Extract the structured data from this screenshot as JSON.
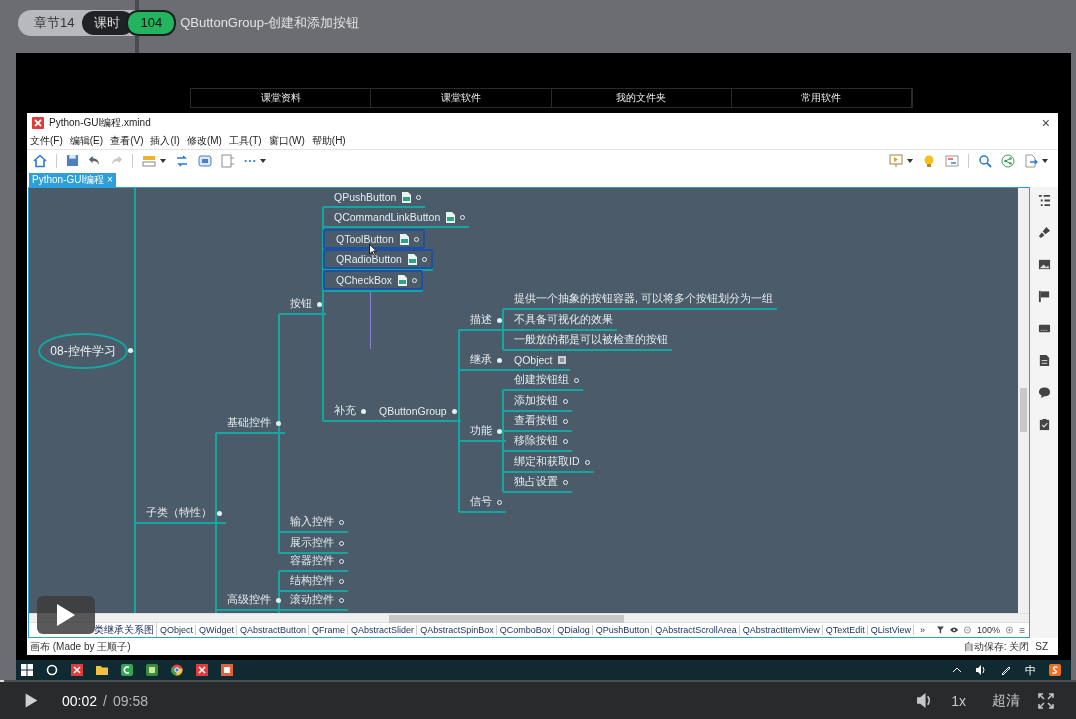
{
  "lesson": {
    "chapter": "章节14",
    "label": "课时",
    "number": "104",
    "title": "QButtonGroup-创建和添加按钮"
  },
  "remote_tabs": [
    "课堂资料",
    "课堂软件",
    "我的文件夹",
    "常用软件"
  ],
  "xmind": {
    "title": "Python-GUI编程.xmind",
    "close": "×",
    "menu": [
      "文件(F)",
      "编辑(E)",
      "查看(V)",
      "插入(I)",
      "修改(M)",
      "工具(T)",
      "窗口(W)",
      "帮助(H)"
    ],
    "doc_tab": {
      "label": "Python-GUI编程",
      "close": "×"
    },
    "mindmap": {
      "label": "08-控件学习",
      "kind": "central",
      "selected": false,
      "children": [
        {
          "label": "子类（特性）",
          "kind": "topic",
          "selected": false,
          "children": [
            {
              "label": "基础控件",
              "kind": "topic",
              "selected": false,
              "children": [
                {
                  "label": "按钮",
                  "kind": "topic",
                  "selected": false,
                  "children": [
                    {
                      "label": "QPushButton",
                      "kind": "note",
                      "selected": false,
                      "collapsed": true
                    },
                    {
                      "label": "QCommandLinkButton",
                      "kind": "note",
                      "selected": false,
                      "collapsed": true
                    },
                    {
                      "label": "QToolButton",
                      "kind": "note",
                      "selected": true,
                      "collapsed": true
                    },
                    {
                      "label": "QRadioButton",
                      "kind": "note",
                      "selected": true,
                      "collapsed": true
                    },
                    {
                      "label": "QCheckBox",
                      "kind": "note",
                      "selected": true,
                      "collapsed": true
                    },
                    {
                      "label": "补充",
                      "kind": "topic",
                      "selected": false,
                      "children": [
                        {
                          "label": "QButtonGroup",
                          "kind": "topic",
                          "selected": false,
                          "children": [
                            {
                              "label": "描述",
                              "kind": "topic",
                              "selected": false,
                              "children": [
                                {
                                  "label": "提供一个抽象的按钮容器, 可以将多个按钮划分为一组",
                                  "kind": "topic",
                                  "selected": false,
                                  "collapsed": false
                                },
                                {
                                  "label": "不具备可视化的效果",
                                  "kind": "topic",
                                  "selected": false,
                                  "collapsed": false
                                },
                                {
                                  "label": "一般放的都是可以被检查的按钮",
                                  "kind": "topic",
                                  "selected": false,
                                  "collapsed": false
                                }
                              ]
                            },
                            {
                              "label": "继承",
                              "kind": "topic",
                              "selected": false,
                              "children": [
                                {
                                  "label": "QObject",
                                  "kind": "link",
                                  "selected": false,
                                  "collapsed": false
                                }
                              ]
                            },
                            {
                              "label": "功能",
                              "kind": "topic",
                              "selected": false,
                              "children": [
                                {
                                  "label": "创建按钮组",
                                  "kind": "topic",
                                  "selected": false,
                                  "collapsed": true
                                },
                                {
                                  "label": "添加按钮",
                                  "kind": "topic",
                                  "selected": false,
                                  "collapsed": true
                                },
                                {
                                  "label": "查看按钮",
                                  "kind": "topic",
                                  "selected": false,
                                  "collapsed": true
                                },
                                {
                                  "label": "移除按钮",
                                  "kind": "topic",
                                  "selected": false,
                                  "collapsed": true
                                },
                                {
                                  "label": "绑定和获取ID",
                                  "kind": "topic",
                                  "selected": false,
                                  "collapsed": true
                                },
                                {
                                  "label": "独占设置",
                                  "kind": "topic",
                                  "selected": false,
                                  "collapsed": true
                                }
                              ]
                            },
                            {
                              "label": "信号",
                              "kind": "topic",
                              "selected": false,
                              "collapsed": true
                            }
                          ]
                        }
                      ]
                    }
                  ]
                },
                {
                  "label": "输入控件",
                  "kind": "topic",
                  "selected": false,
                  "collapsed": true
                },
                {
                  "label": "展示控件",
                  "kind": "topic",
                  "selected": false,
                  "collapsed": true
                }
              ]
            },
            {
              "label": "高级控件",
              "kind": "topic",
              "selected": false,
              "children": [
                {
                  "label": "容器控件",
                  "kind": "topic",
                  "selected": false,
                  "collapsed": true
                },
                {
                  "label": "结构控件",
                  "kind": "topic",
                  "selected": false,
                  "collapsed": true
                },
                {
                  "label": "滚动控件",
                  "kind": "topic",
                  "selected": false,
                  "collapsed": true
                }
              ]
            }
          ]
        }
      ]
    },
    "sheets": [
      "类继承关系图",
      "QObject",
      "QWidget",
      "QAbstractButton",
      "QFrame",
      "QAbstractSlider",
      "QAbstractSpinBox",
      "QComboBox",
      "QDialog",
      "QPushButton",
      "QAbstractScrollArea",
      "QAbstractItemView",
      "QTextEdit",
      "QListView"
    ],
    "sheets_more": "»",
    "zoom": "100%",
    "status": "画布 (Made by 王顺子)",
    "autosave": "自动保存: 关闭",
    "user": "SZ"
  },
  "taskbar": {
    "ime": "中"
  },
  "player": {
    "current": "00:02",
    "separator": "/",
    "duration": "09:58",
    "level": 0.0033,
    "speed": "1x",
    "quality": "超清"
  }
}
